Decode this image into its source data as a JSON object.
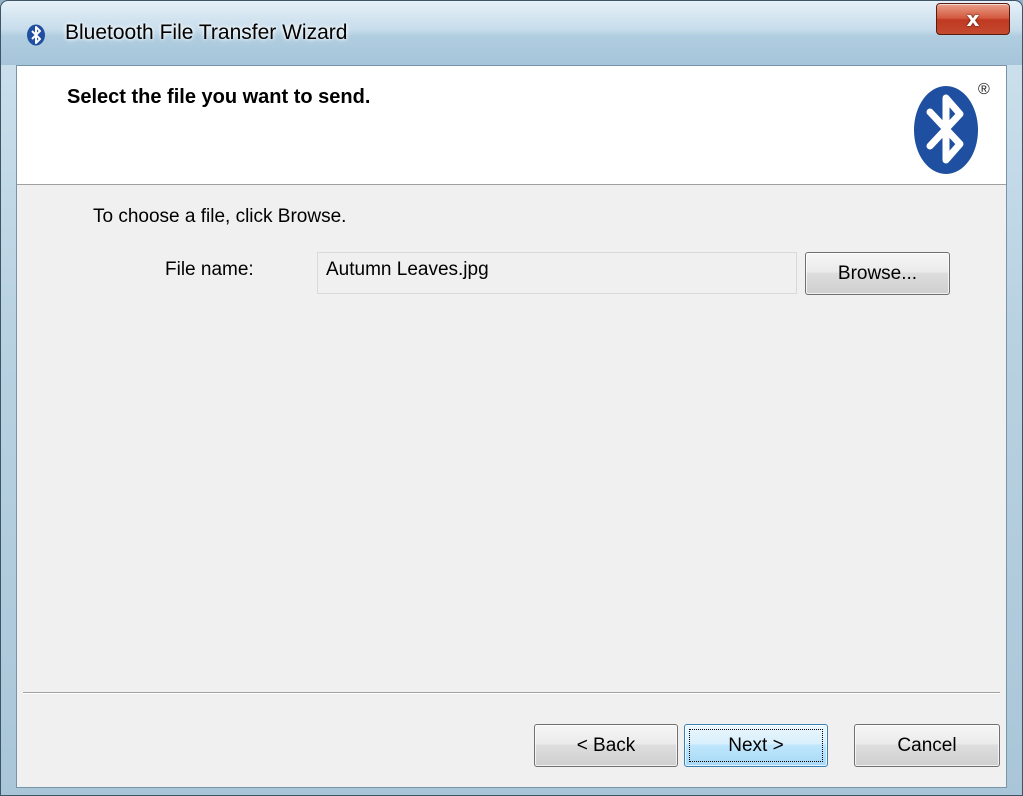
{
  "window": {
    "title": "Bluetooth File Transfer Wizard",
    "close_glyph": "x",
    "icon": "bluetooth-icon"
  },
  "header": {
    "title": "Select the file you want to send.",
    "logo": "bluetooth-logo",
    "registered_mark": "®"
  },
  "main": {
    "instruction": "To choose a file, click Browse.",
    "file_label": "File name:",
    "file_value": "Autumn Leaves.jpg",
    "browse_label": "Browse..."
  },
  "footer": {
    "back_label": "< Back",
    "next_label": "Next >",
    "cancel_label": "Cancel"
  },
  "colors": {
    "bluetooth_blue": "#1e4fa0",
    "close_red": "#c4492f",
    "dialog_bg": "#f0f0f0"
  }
}
